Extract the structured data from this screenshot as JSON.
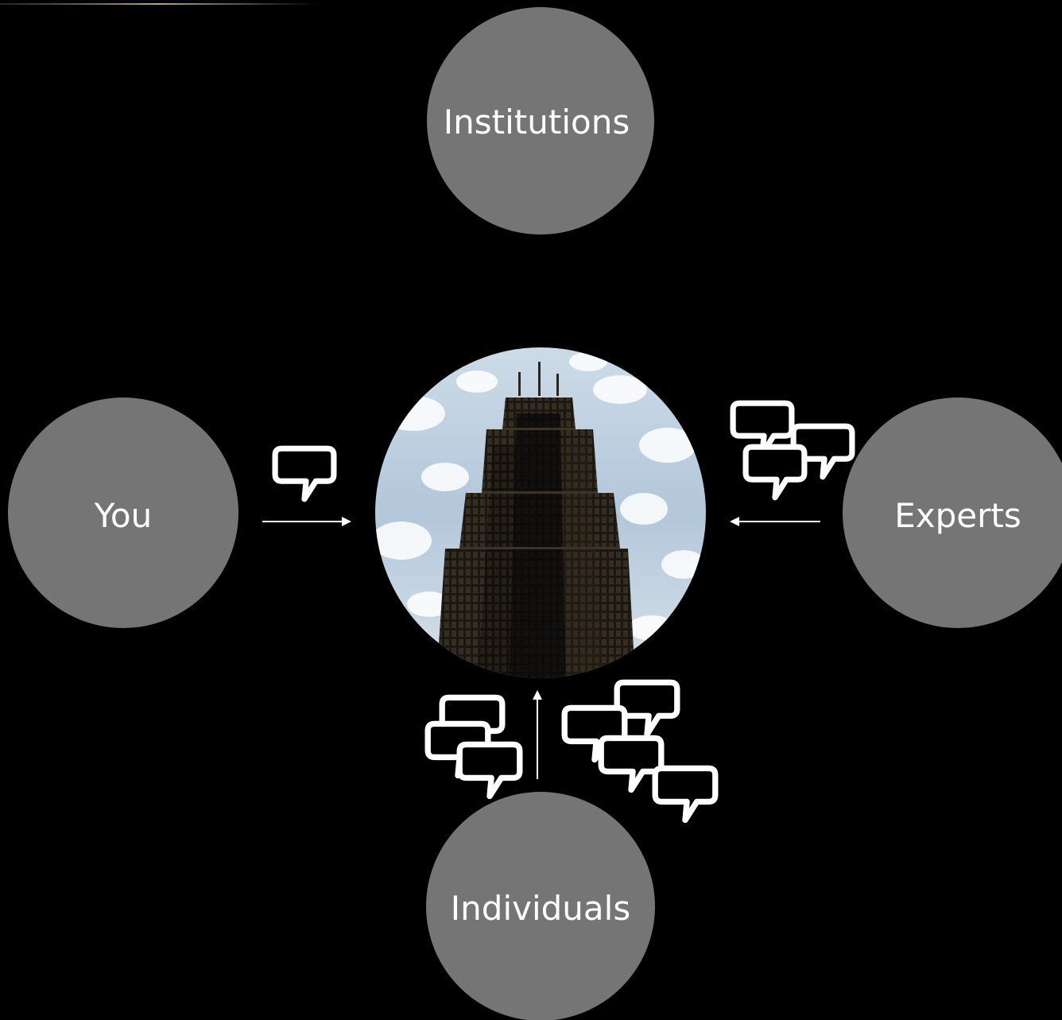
{
  "colors": {
    "background": "#000000",
    "node_fill": "#757575",
    "label": "#ffffff",
    "stroke": "#ffffff",
    "accent_line": "#c8b98a"
  },
  "nodes": {
    "institutions": {
      "label": "Institutions"
    },
    "you": {
      "label": "You"
    },
    "experts": {
      "label": "Experts"
    },
    "individuals": {
      "label": "Individuals"
    }
  },
  "center": {
    "image": "skyscraper-photo"
  },
  "icons": [
    "speech-bubble-icon",
    "arrow-right-icon",
    "arrow-left-icon",
    "arrow-up-icon"
  ]
}
